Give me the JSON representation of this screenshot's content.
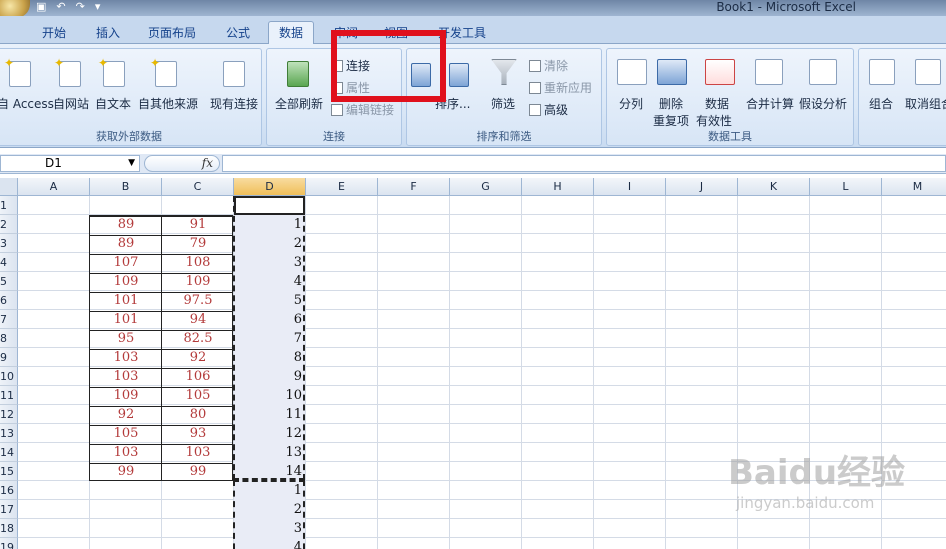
{
  "window": {
    "title": "Book1 - Microsoft Excel",
    "qat": [
      "save-icon",
      "undo-icon",
      "redo-icon",
      "customize-icon"
    ]
  },
  "tabs": [
    {
      "label": "开始",
      "active": false
    },
    {
      "label": "插入",
      "active": false
    },
    {
      "label": "页面布局",
      "active": false
    },
    {
      "label": "公式",
      "active": false
    },
    {
      "label": "数据",
      "active": true
    },
    {
      "label": "审阅",
      "active": false
    },
    {
      "label": "视图",
      "active": false
    },
    {
      "label": "开发工具",
      "active": false
    }
  ],
  "ribbon": {
    "get_external": {
      "label": "获取外部数据",
      "buttons": [
        "自 Access",
        "自网站",
        "自文本",
        "自其他来源",
        "现有连接"
      ]
    },
    "connections": {
      "label": "连接",
      "refresh_all": "全部刷新",
      "connections": "连接",
      "properties": "属性",
      "edit_links": "编辑链接"
    },
    "sort_filter": {
      "label": "排序和筛选",
      "sort": "排序...",
      "filter": "筛选",
      "clear": "清除",
      "reapply": "重新应用",
      "advanced": "高级"
    },
    "data_tools": {
      "label": "数据工具",
      "text_to_columns": "分列",
      "remove_duplicates_1": "删除",
      "remove_duplicates_2": "重复项",
      "validation_1": "数据",
      "validation_2": "有效性",
      "consolidate": "合并计算",
      "what_if": "假设分析"
    },
    "outline": {
      "group": "组合",
      "ungroup": "取消组合"
    }
  },
  "formula_bar": {
    "name_box": "D1",
    "fx": "fx",
    "content": ""
  },
  "sheet": {
    "columns": [
      "A",
      "B",
      "C",
      "D",
      "E",
      "F",
      "G",
      "H",
      "I",
      "J",
      "K",
      "L",
      "M"
    ],
    "rows": [
      "1",
      "2",
      "3",
      "4",
      "5",
      "6",
      "7",
      "8",
      "9",
      "10",
      "11",
      "12",
      "13",
      "14",
      "15",
      "16",
      "17",
      "18",
      "19"
    ],
    "col_b": [
      "89",
      "89",
      "107",
      "109",
      "101",
      "101",
      "95",
      "103",
      "103",
      "109",
      "92",
      "105",
      "103",
      "99"
    ],
    "col_c": [
      "91",
      "79",
      "108",
      "109",
      "97.5",
      "94",
      "82.5",
      "92",
      "106",
      "105",
      "80",
      "93",
      "103",
      "99"
    ],
    "col_d": [
      "1",
      "2",
      "3",
      "4",
      "5",
      "6",
      "7",
      "8",
      "9",
      "10",
      "11",
      "12",
      "13",
      "14",
      "1",
      "2",
      "3",
      "4"
    ],
    "selected_cell": "D1"
  },
  "watermark": {
    "logo": "Baidu经验",
    "url": "jingyan.baidu.com"
  },
  "colors": {
    "highlight_box": "#e0101c",
    "cell_text": "#b33a3a"
  }
}
